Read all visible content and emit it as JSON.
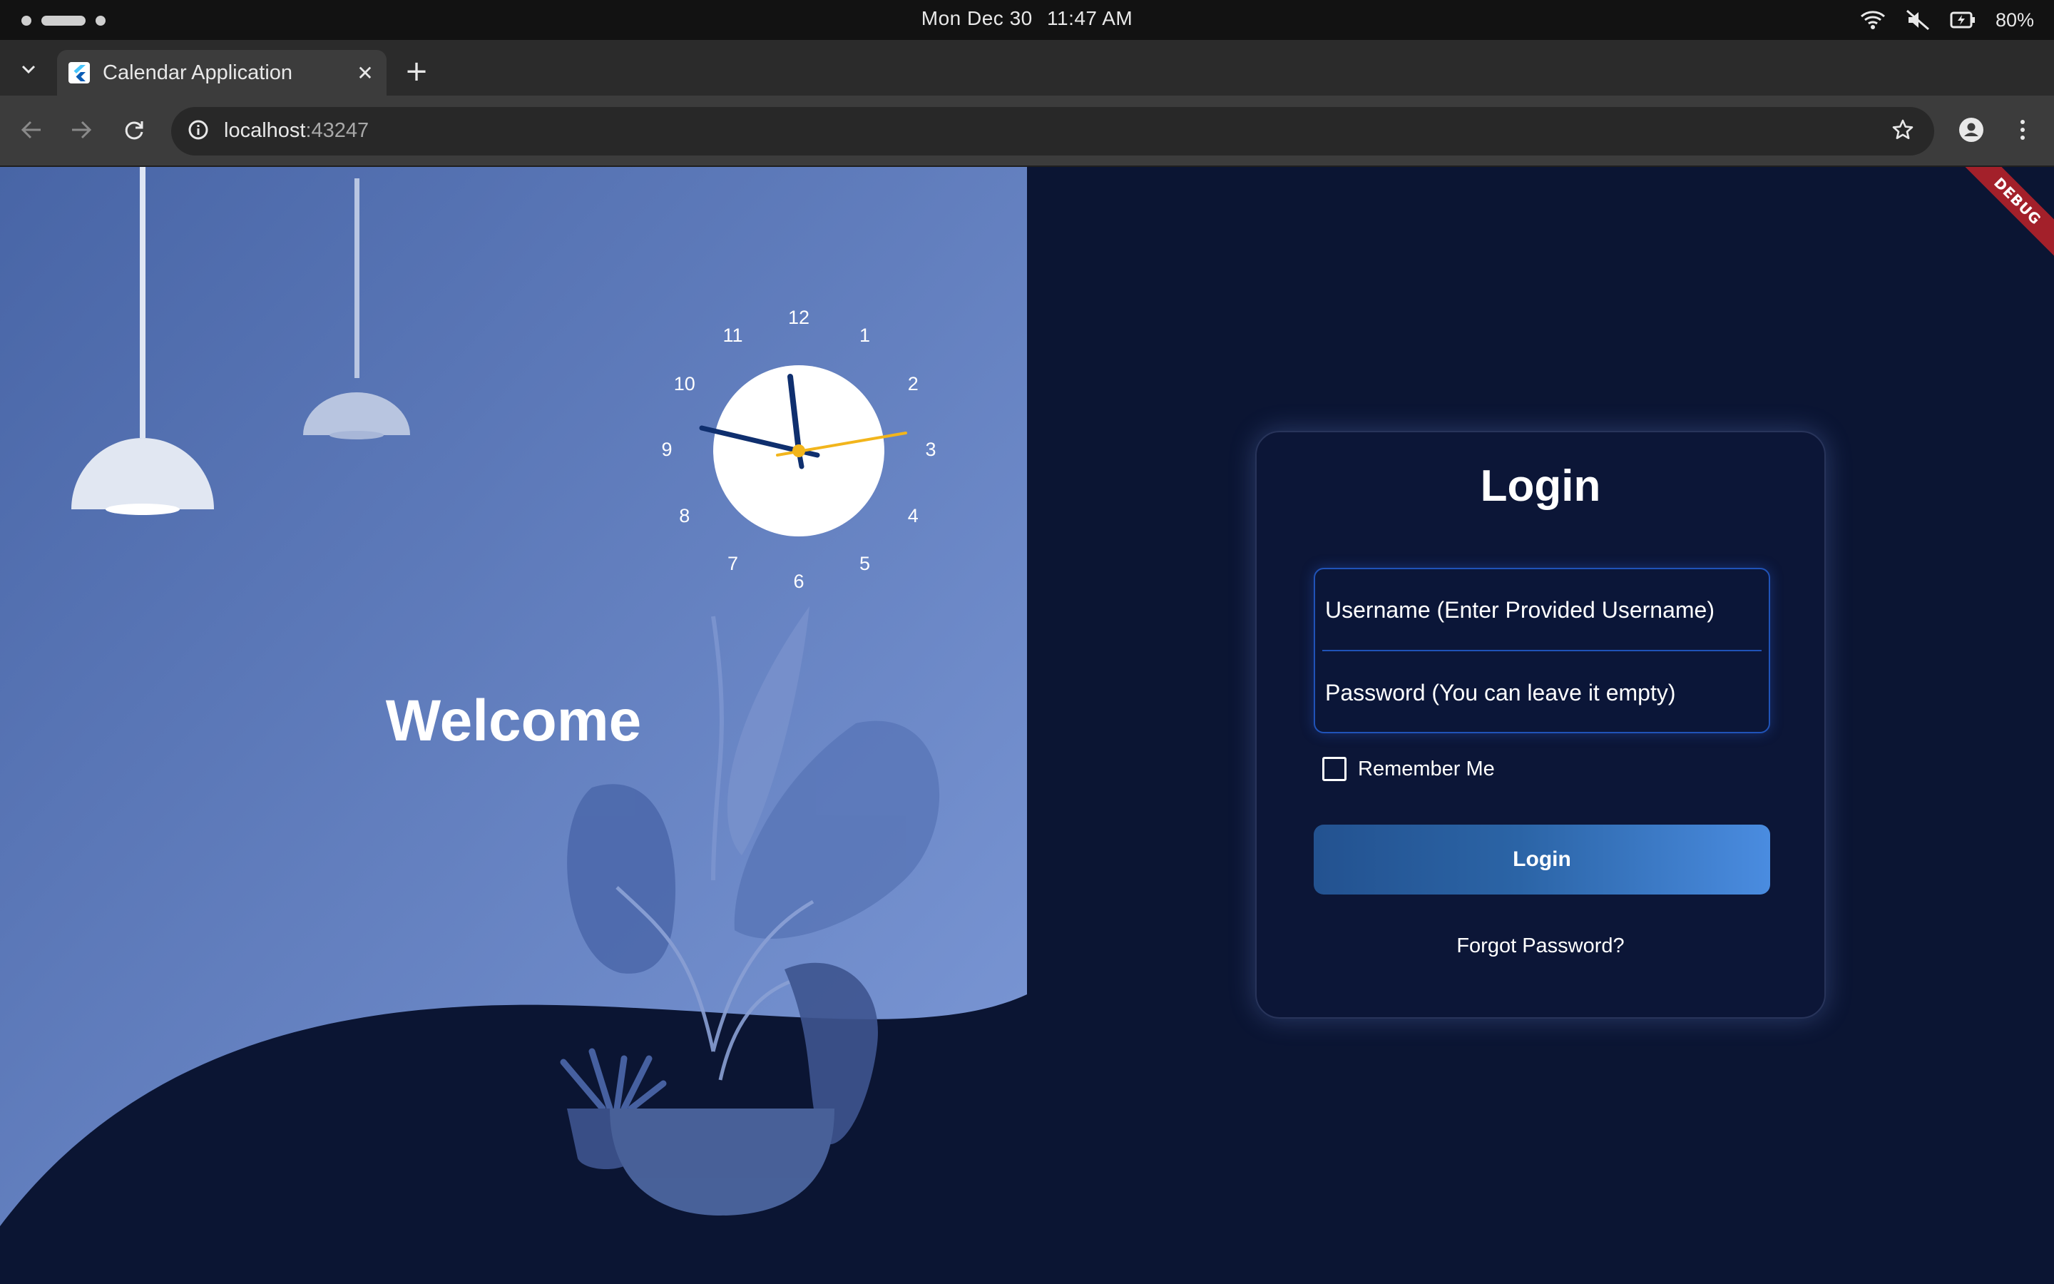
{
  "os": {
    "date": "Mon Dec 30",
    "time": "11:47 AM",
    "battery": "80%"
  },
  "browser": {
    "tab_title": "Calendar Application",
    "close_glyph": "✕",
    "new_tab_glyph": "+",
    "url_host": "localhost",
    "url_port": ":43247"
  },
  "app": {
    "debug_banner": "DEBUG",
    "welcome": "Welcome",
    "clock": {
      "numbers": [
        "12",
        "1",
        "2",
        "3",
        "4",
        "5",
        "6",
        "7",
        "8",
        "9",
        "10",
        "11"
      ],
      "time_shown": "11:47",
      "hour_hand_color": "#0f2f6e",
      "second_hand_color": "#f2b51c"
    },
    "login": {
      "title": "Login",
      "username_placeholder": "Username (Enter Provided Username)",
      "password_placeholder": "Password (You can leave it empty)",
      "remember_label": "Remember Me",
      "remember_checked": false,
      "button_label": "Login",
      "forgot_label": "Forgot Password?"
    }
  },
  "colors": {
    "page_background": "#0b1533",
    "panel_gradient_start": "#4865a6",
    "panel_gradient_end": "#7e9ad8",
    "button_gradient_start": "#235290",
    "button_gradient_end": "#4a8ce0",
    "field_border": "#2053b8"
  },
  "icons": [
    "wifi-icon",
    "mute-icon",
    "battery-icon",
    "tab-search-icon",
    "flutter-icon",
    "back-icon",
    "forward-icon",
    "reload-icon",
    "info-icon",
    "bookmark-star-icon",
    "profile-icon",
    "menu-icon",
    "lamp-icon",
    "clock-icon",
    "plant-icon"
  ]
}
